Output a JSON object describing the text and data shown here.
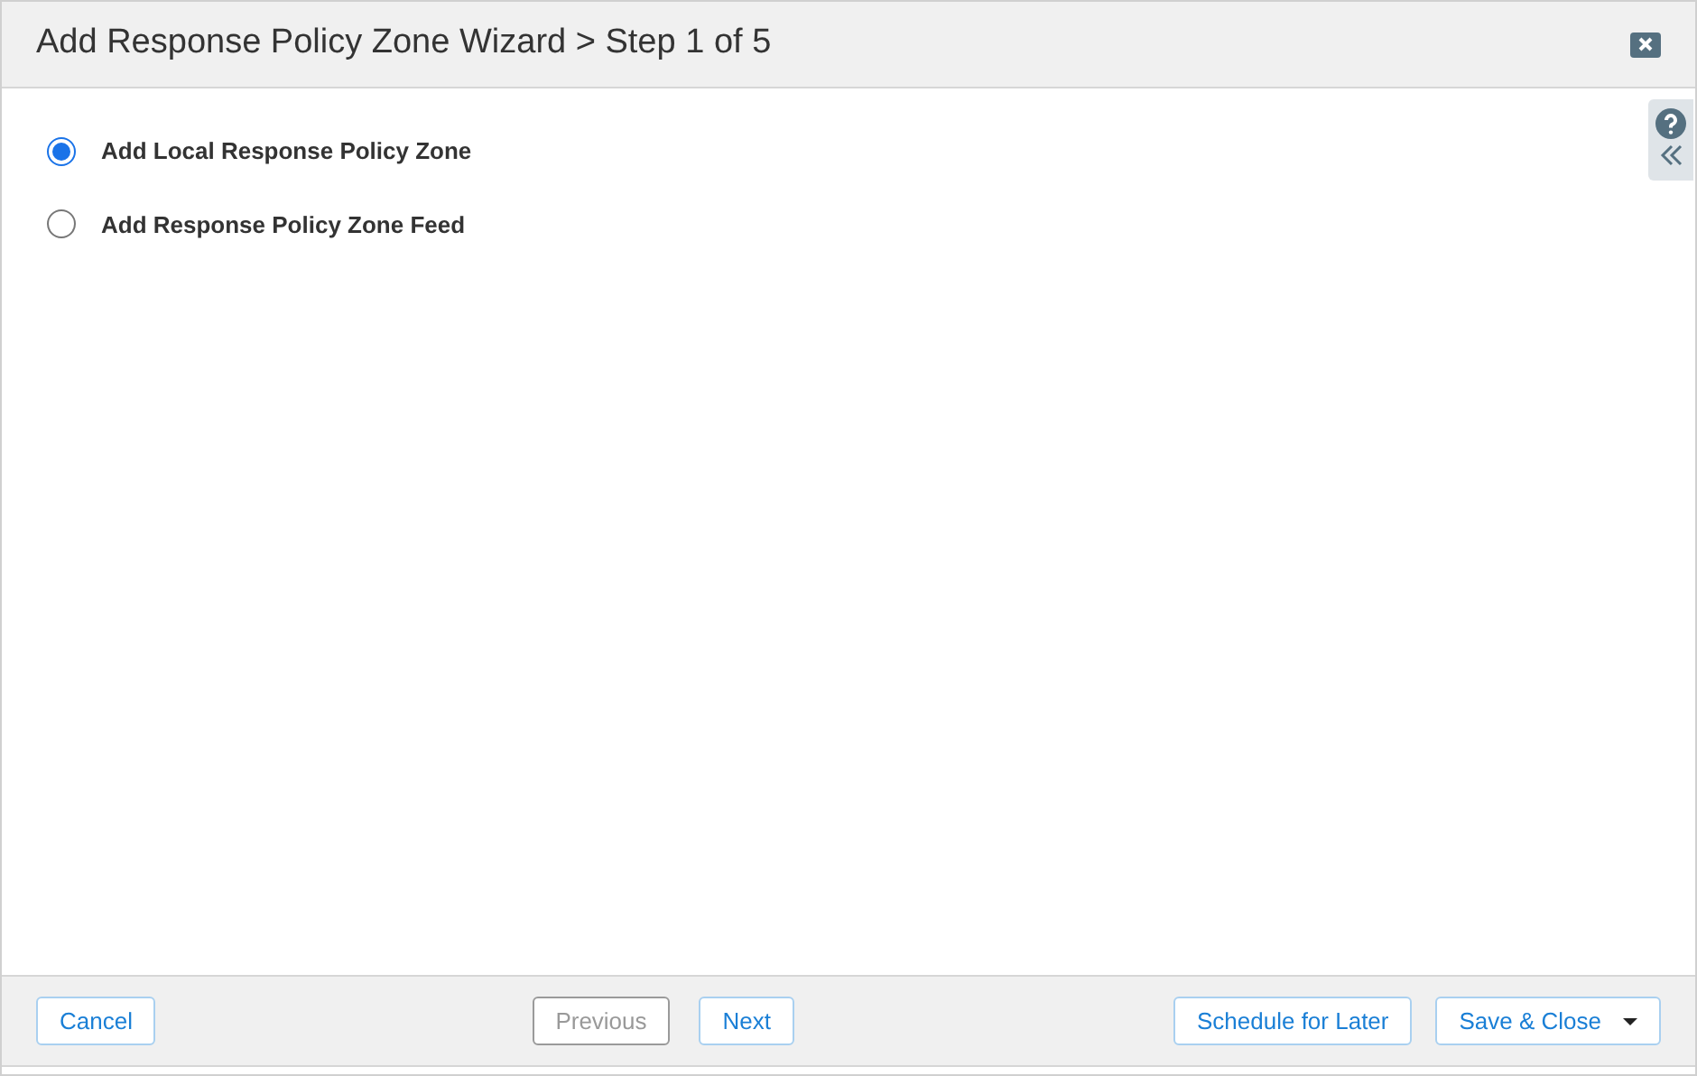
{
  "window": {
    "title": "Add Response Policy Zone Wizard > Step 1 of 5"
  },
  "options": [
    {
      "label": "Add Local Response Policy Zone",
      "selected": true
    },
    {
      "label": "Add Response Policy Zone Feed",
      "selected": false
    }
  ],
  "footer": {
    "cancel": {
      "label": "Cancel",
      "disabled": false
    },
    "previous": {
      "label": "Previous",
      "disabled": true
    },
    "next": {
      "label": "Next",
      "disabled": false
    },
    "schedule": {
      "label": "Schedule for Later",
      "disabled": false
    },
    "save": {
      "label": "Save & Close",
      "disabled": false
    }
  }
}
